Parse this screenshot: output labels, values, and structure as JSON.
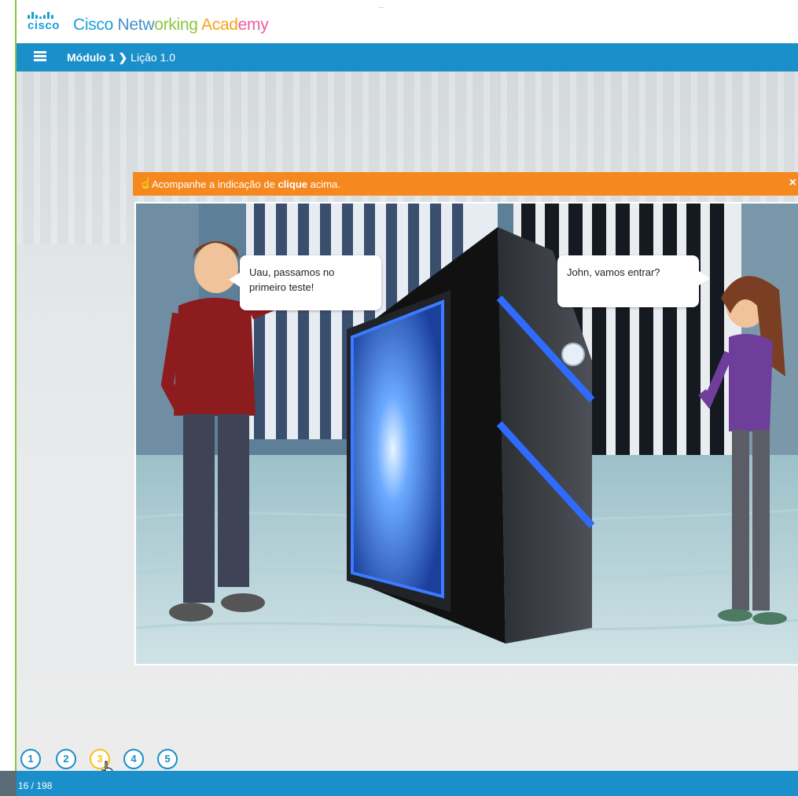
{
  "header": {
    "logo_word": "cisco",
    "app_title": [
      "Cisco ",
      "Netw",
      "orking ",
      "Acad",
      "emy"
    ],
    "top_caption": "..."
  },
  "navbar": {
    "module": "Módulo 1",
    "separator": "❯",
    "lesson": "Lição 1.0"
  },
  "notice": {
    "prefix": "Acompanhe a indicação de ",
    "bold": "clique",
    "suffix": " acima.",
    "close": "×"
  },
  "scene": {
    "bubble_left": "Uau, passamos no primeiro teste!",
    "bubble_right": "John, vamos entrar?"
  },
  "pager": {
    "pages": [
      "1",
      "2",
      "3",
      "4",
      "5"
    ],
    "active_index": 2
  },
  "footer": {
    "counter": "16 / 198"
  },
  "colors": {
    "brand_blue": "#1b8fc9",
    "notice_orange": "#f5891f",
    "active_yellow": "#f6c11b"
  },
  "icons": {
    "menu": "hamburger-icon",
    "notice": "hand-pointer-icon",
    "close": "close-icon",
    "cursor": "hand-cursor-icon"
  }
}
